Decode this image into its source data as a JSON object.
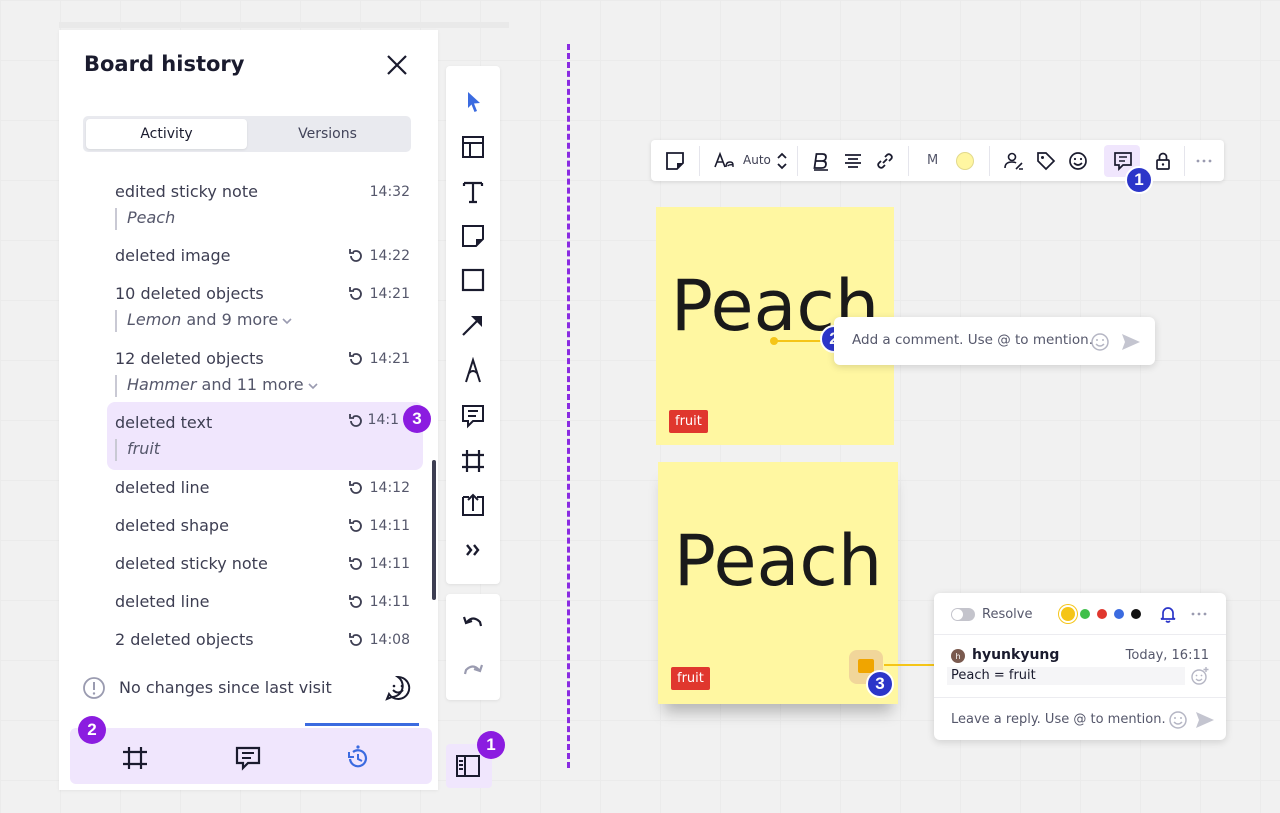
{
  "panel": {
    "title": "Board history",
    "tabs": [
      {
        "label": "Activity",
        "active": true
      },
      {
        "label": "Versions",
        "active": false
      }
    ],
    "activity": [
      {
        "action": "edited sticky note",
        "time": "14:32",
        "detail": "Peach",
        "restorable": false
      },
      {
        "action": "deleted image",
        "time": "14:22",
        "restorable": true
      },
      {
        "action": "10 deleted objects",
        "time": "14:21",
        "detail": "Lemon",
        "detail_more": "and 9 more",
        "restorable": true
      },
      {
        "action": "12 deleted objects",
        "time": "14:21",
        "detail": "Hammer",
        "detail_more": "and 11 more",
        "restorable": true
      },
      {
        "action": "deleted text",
        "time": "14:1",
        "detail": "fruit",
        "restorable": true,
        "selected": true
      },
      {
        "action": "deleted line",
        "time": "14:12",
        "restorable": true
      },
      {
        "action": "deleted shape",
        "time": "14:11",
        "restorable": true
      },
      {
        "action": "deleted sticky note",
        "time": "14:11",
        "restorable": true
      },
      {
        "action": "deleted line",
        "time": "14:11",
        "restorable": true
      },
      {
        "action": "2 deleted objects",
        "time": "14:08",
        "restorable": true
      }
    ],
    "footer_info": "No changes since last visit",
    "bottom_nav": [
      "frames-icon",
      "comments-icon",
      "history-icon"
    ],
    "active_nav": "history-icon"
  },
  "badges": {
    "one": "1",
    "two": "2",
    "three": "3"
  },
  "toolbar": {
    "tools": [
      "select-icon",
      "templates-icon",
      "text-icon",
      "sticky-note-icon",
      "shape-icon",
      "connection-line-icon",
      "pen-icon",
      "comment-icon",
      "frame-icon",
      "upload-icon",
      "more-tools-icon"
    ]
  },
  "context_toolbar": {
    "font_size": "Auto",
    "size_label": "M",
    "sticky_color": "#fff6a1"
  },
  "stickies": [
    {
      "text": "Peach",
      "tag": "fruit"
    },
    {
      "text": "Peach",
      "tag": "fruit"
    }
  ],
  "comment_input": {
    "placeholder": "Add a comment. Use @ to mention."
  },
  "thread": {
    "resolve_label": "Resolve",
    "colors": [
      "#f5c518",
      "#3fbf4a",
      "#e0372e",
      "#3b6be0",
      "#111111"
    ],
    "avatar_initial": "h",
    "author": "hyunkyung",
    "time": "Today, 16:11",
    "text": "Peach = fruit",
    "reply_placeholder": "Leave a reply. Use @ to mention."
  },
  "colors": {
    "accent_purple": "#8b1ce0",
    "badge_blue": "#2c36c9",
    "selection_bg": "#f0e6fd",
    "sticky_yellow": "#fff7a1",
    "tag_red": "#e0372e",
    "active_blue": "#3b6be0"
  }
}
